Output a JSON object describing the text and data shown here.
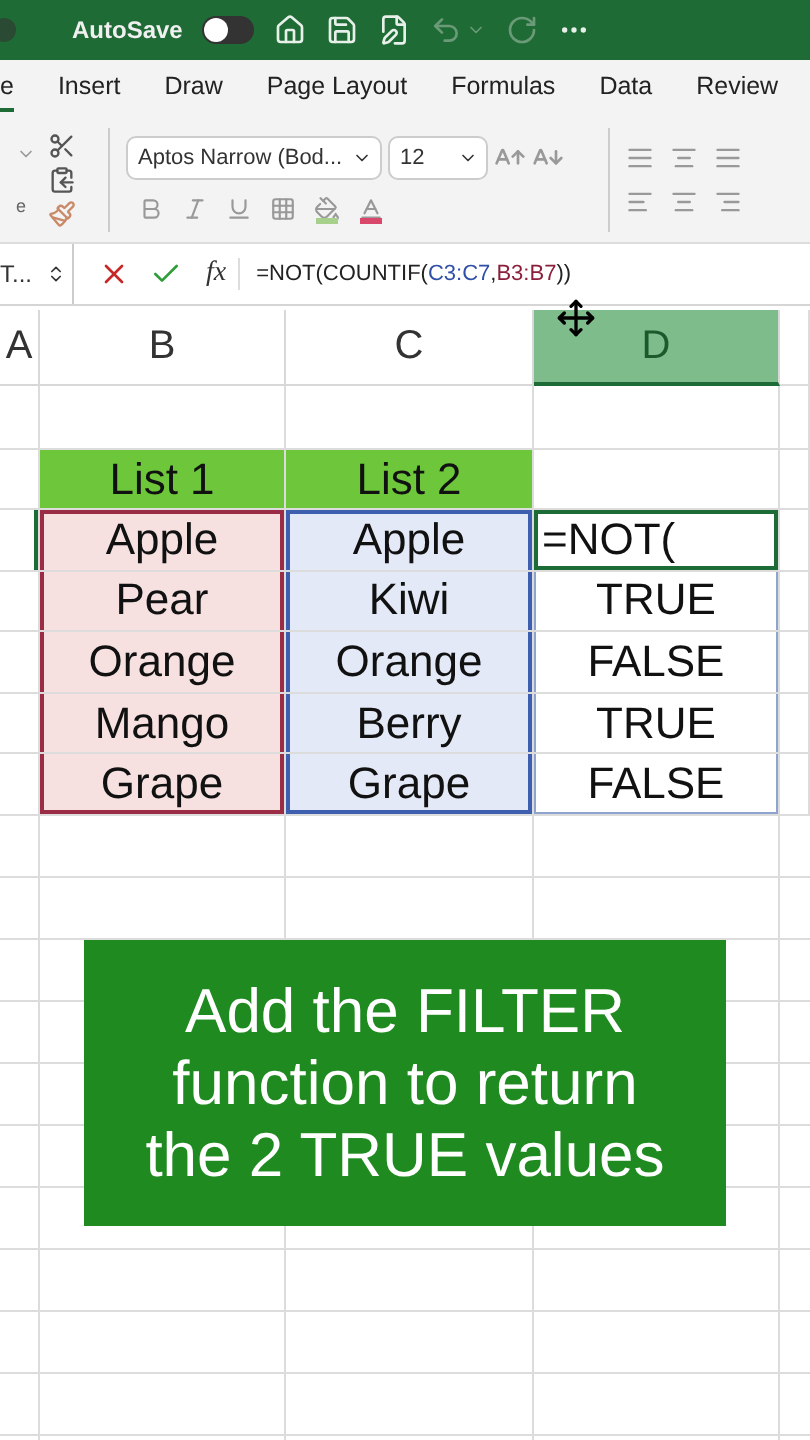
{
  "title_bar": {
    "autosave_label": "AutoSave",
    "autosave_on": false
  },
  "ribbon_tabs": [
    {
      "label": "e",
      "selected": true
    },
    {
      "label": "Insert",
      "selected": false
    },
    {
      "label": "Draw",
      "selected": false
    },
    {
      "label": "Page Layout",
      "selected": false
    },
    {
      "label": "Formulas",
      "selected": false
    },
    {
      "label": "Data",
      "selected": false
    },
    {
      "label": "Review",
      "selected": false
    }
  ],
  "ribbon": {
    "paste_label": "e",
    "font_name": "Aptos Narrow (Bod...",
    "font_size": "12"
  },
  "formula_bar": {
    "name_box": "T...",
    "fx": "fx",
    "formula": [
      {
        "text": "=NOT(COUNTIF(",
        "color": "#222222"
      },
      {
        "text": "C3:C7",
        "color": "#2f4fa8"
      },
      {
        "text": ",",
        "color": "#222222"
      },
      {
        "text": "B3:B7",
        "color": "#8b1e3a"
      },
      {
        "text": "))",
        "color": "#222222"
      }
    ]
  },
  "columns": [
    {
      "label": "A",
      "selected": false
    },
    {
      "label": "B",
      "selected": false
    },
    {
      "label": "C",
      "selected": false
    },
    {
      "label": "D",
      "selected": true
    }
  ],
  "header_row": [
    "List 1",
    "List 2"
  ],
  "rows": [
    {
      "list_1": "Apple",
      "list_2": "Apple",
      "result": "=NOT(",
      "editing": true
    },
    {
      "list_1": "Pear",
      "list_2": "Kiwi",
      "result": "TRUE",
      "editing": false
    },
    {
      "list_1": "Orange",
      "list_2": "Orange",
      "result": "FALSE",
      "editing": false
    },
    {
      "list_1": "Mango",
      "list_2": "Berry",
      "result": "TRUE",
      "editing": false
    },
    {
      "list_1": "Grape",
      "list_2": "Grape",
      "result": "FALSE",
      "editing": false
    }
  ],
  "callout": "Add the FILTER function to return the 2 TRUE values"
}
